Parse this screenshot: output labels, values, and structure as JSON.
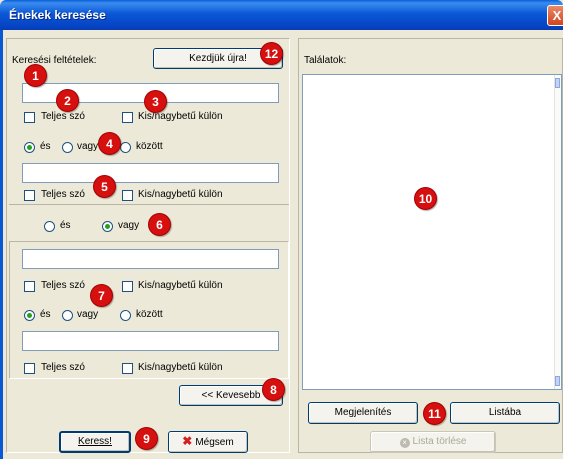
{
  "window": {
    "title": "Énekek keresése",
    "close_label": "X"
  },
  "left": {
    "criteria_label": "Keresési feltételek:",
    "restart_button": "Kezdjük újra!",
    "row1": {
      "input_value": "",
      "whole_word": "Teljes szó",
      "case_sensitive": "Kis/nagybetű külön"
    },
    "op1": {
      "and": "és",
      "or": "vagy",
      "between": "között",
      "selected": "and"
    },
    "row2": {
      "input_value": "",
      "whole_word": "Teljes szó",
      "case_sensitive": "Kis/nagybetű külön"
    },
    "group_op": {
      "and": "és",
      "or": "vagy",
      "selected": "or"
    },
    "row3": {
      "input_value": "",
      "whole_word": "Teljes szó",
      "case_sensitive": "Kis/nagybetű külön"
    },
    "op2": {
      "and": "és",
      "or": "vagy",
      "between": "között",
      "selected": "and"
    },
    "row4": {
      "input_value": "",
      "whole_word": "Teljes szó",
      "case_sensitive": "Kis/nagybetű külön"
    },
    "fewer_button": "<< Kevesebb",
    "search_button": "Keress!",
    "cancel_button": "Mégsem"
  },
  "right": {
    "results_label": "Találatok:",
    "display_button": "Megjelenítés",
    "to_list_button": "Listába",
    "clear_list_button": "Lista törlése"
  },
  "badges": [
    "1",
    "2",
    "3",
    "4",
    "5",
    "6",
    "7",
    "8",
    "9",
    "10",
    "11",
    "12"
  ],
  "colors": {
    "badge": "#d60f0f",
    "title_bar": "#0b58d6",
    "window_bg": "#ece9d8"
  },
  "icons": {
    "cancel": "x-icon",
    "clear": "delete-icon",
    "close": "close-icon"
  }
}
